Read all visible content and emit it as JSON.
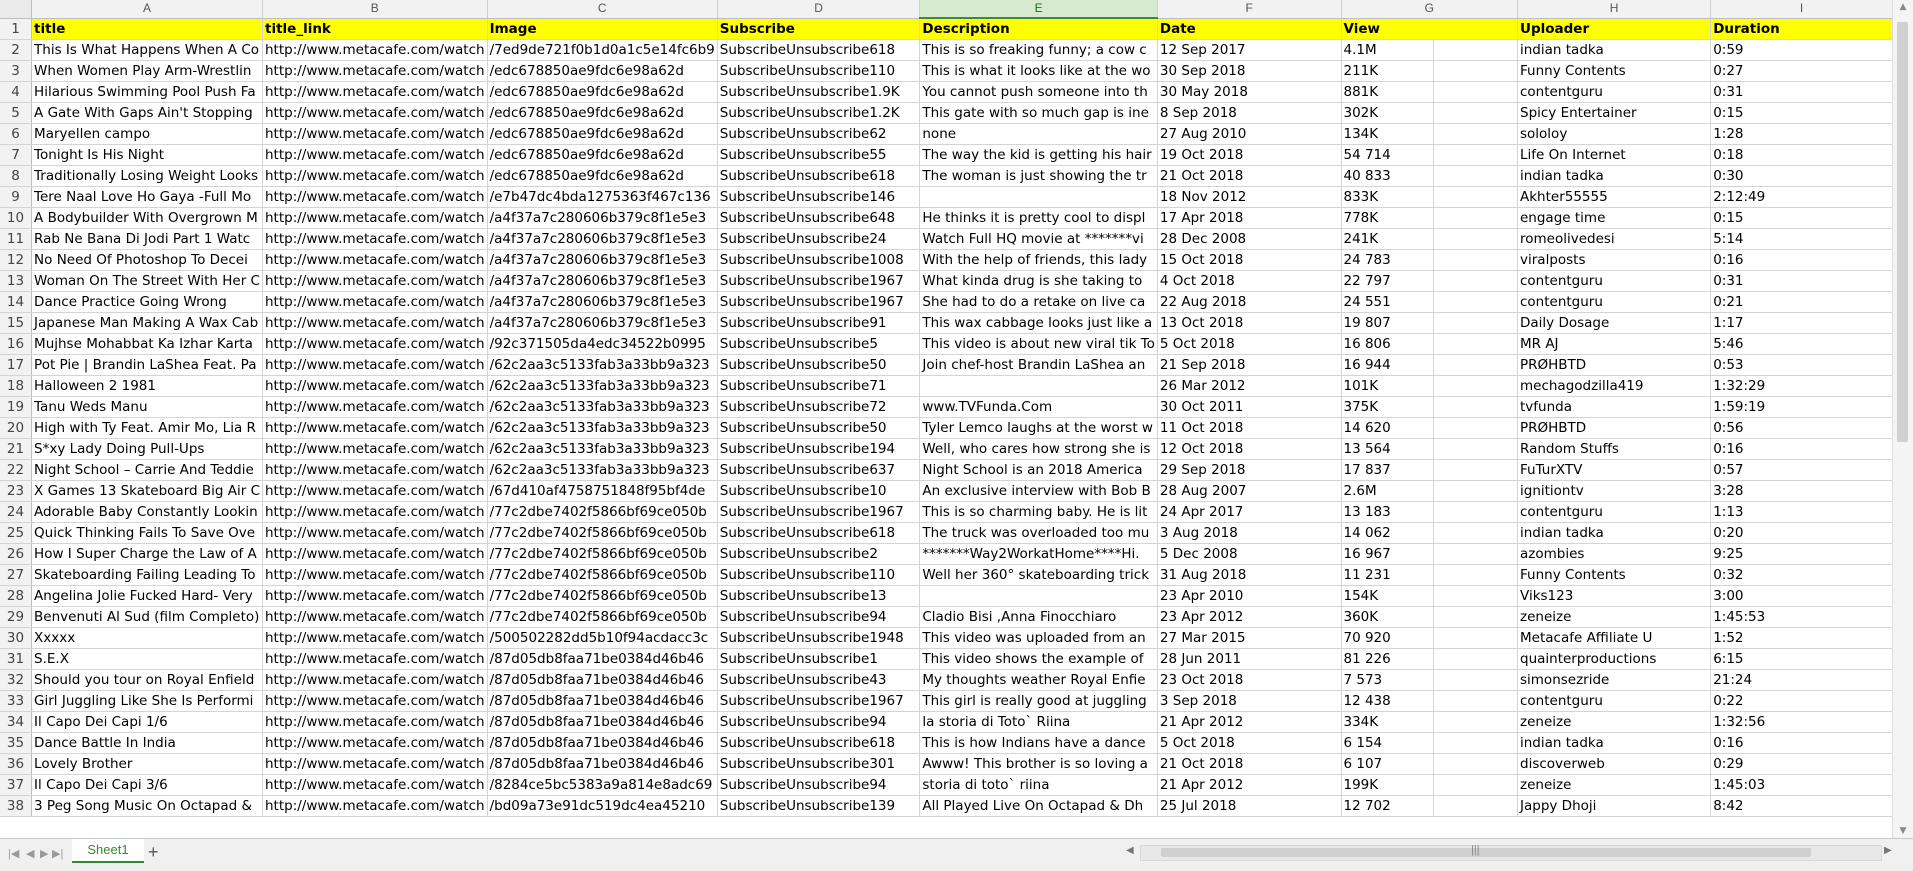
{
  "columns": {
    "letters": [
      "A",
      "B",
      "C",
      "D",
      "E",
      "F",
      "G",
      "H",
      "I"
    ],
    "active": "E"
  },
  "header_row": [
    "title",
    "title_link",
    "Image",
    "Subscribe",
    "Description",
    "Date",
    "View",
    "Uploader",
    "Duration"
  ],
  "rows": [
    {
      "n": "2",
      "cells": [
        "This Is What Happens When A Co",
        "http://www.metacafe.com/watch",
        "/7ed9de721f0b1d0a1c5e14fc6b9",
        "SubscribeUnsubscribe618",
        "This is so freaking funny; a cow c",
        "12 Sep 2017",
        "4.1M",
        "",
        "indian tadka",
        "0:59"
      ]
    },
    {
      "n": "3",
      "cells": [
        "When Women Play Arm-Wrestlin",
        "http://www.metacafe.com/watch",
        "/edc678850ae9fdc6e98a62d",
        "SubscribeUnsubscribe110",
        "This is what it looks like at the wo",
        "30 Sep 2018",
        "211K",
        "",
        "Funny Contents",
        "0:27"
      ]
    },
    {
      "n": "4",
      "cells": [
        "Hilarious Swimming Pool Push Fa",
        "http://www.metacafe.com/watch",
        "/edc678850ae9fdc6e98a62d",
        "SubscribeUnsubscribe1.9K",
        "You cannot push someone into th",
        "30 May 2018",
        "881K",
        "",
        "contentguru",
        "0:31"
      ]
    },
    {
      "n": "5",
      "cells": [
        "A Gate With Gaps Ain't Stopping",
        "http://www.metacafe.com/watch",
        "/edc678850ae9fdc6e98a62d",
        "SubscribeUnsubscribe1.2K",
        "This gate with so much gap is ine",
        "8 Sep 2018",
        "302K",
        "",
        "Spicy Entertainer",
        "0:15"
      ]
    },
    {
      "n": "6",
      "cells": [
        "Maryellen campo",
        "http://www.metacafe.com/watch",
        "/edc678850ae9fdc6e98a62d",
        "SubscribeUnsubscribe62",
        "none",
        "27 Aug 2010",
        "134K",
        "",
        "sololoy",
        "1:28"
      ]
    },
    {
      "n": "7",
      "cells": [
        "Tonight Is His Night",
        "http://www.metacafe.com/watch",
        "/edc678850ae9fdc6e98a62d",
        "SubscribeUnsubscribe55",
        "The way the kid is getting his hair",
        "19 Oct 2018",
        "54 714",
        "",
        "Life On Internet",
        "0:18"
      ]
    },
    {
      "n": "8",
      "cells": [
        "Traditionally Losing Weight Looks",
        "http://www.metacafe.com/watch",
        "/edc678850ae9fdc6e98a62d",
        "SubscribeUnsubscribe618",
        "The woman is just showing the tr",
        "21 Oct 2018",
        "40 833",
        "",
        "indian tadka",
        "0:30"
      ]
    },
    {
      "n": "9",
      "cells": [
        "Tere Naal Love Ho Gaya -Full Mo",
        "http://www.metacafe.com/watch",
        "/e7b47dc4bda1275363f467c136",
        "SubscribeUnsubscribe146",
        "",
        "18 Nov 2012",
        "833K",
        "",
        "Akhter55555",
        "2:12:49"
      ]
    },
    {
      "n": "10",
      "cells": [
        "A Bodybuilder With Overgrown M",
        "http://www.metacafe.com/watch",
        "/a4f37a7c280606b379c8f1e5e3",
        "SubscribeUnsubscribe648",
        "He thinks it is pretty cool to displ",
        "17 Apr 2018",
        "778K",
        "",
        "engage time",
        "0:15"
      ]
    },
    {
      "n": "11",
      "cells": [
        "Rab Ne Bana Di Jodi Part 1 Watc",
        "http://www.metacafe.com/watch",
        "/a4f37a7c280606b379c8f1e5e3",
        "SubscribeUnsubscribe24",
        "Watch Full HQ movie at *******vi",
        "28 Dec 2008",
        "241K",
        "",
        "romeolivedesi",
        "5:14"
      ]
    },
    {
      "n": "12",
      "cells": [
        "No Need Of Photoshop To Decei",
        "http://www.metacafe.com/watch",
        "/a4f37a7c280606b379c8f1e5e3",
        "SubscribeUnsubscribe1008",
        "With the help of friends, this lady",
        "15 Oct 2018",
        "24 783",
        "",
        "viralposts",
        "0:16"
      ]
    },
    {
      "n": "13",
      "cells": [
        "Woman On The Street With Her C",
        "http://www.metacafe.com/watch",
        "/a4f37a7c280606b379c8f1e5e3",
        "SubscribeUnsubscribe1967",
        "What kinda drug is she taking to",
        "4 Oct 2018",
        "22 797",
        "",
        "contentguru",
        "0:31"
      ]
    },
    {
      "n": "14",
      "cells": [
        "Dance Practice Going Wrong",
        "http://www.metacafe.com/watch",
        "/a4f37a7c280606b379c8f1e5e3",
        "SubscribeUnsubscribe1967",
        "She had to do a retake on live ca",
        "22 Aug 2018",
        "24 551",
        "",
        "contentguru",
        "0:21"
      ]
    },
    {
      "n": "15",
      "cells": [
        "Japanese Man Making A Wax Cab",
        "http://www.metacafe.com/watch",
        "/a4f37a7c280606b379c8f1e5e3",
        "SubscribeUnsubscribe91",
        "This wax cabbage looks just like a",
        "13 Oct 2018",
        "19 807",
        "",
        "Daily Dosage",
        "1:17"
      ]
    },
    {
      "n": "16",
      "cells": [
        "Mujhse Mohabbat Ka Izhar Karta",
        "http://www.metacafe.com/watch",
        "/92c371505da4edc34522b0995",
        "SubscribeUnsubscribe5",
        "This video is about new viral tik To",
        "5 Oct 2018",
        "16 806",
        "",
        "MR AJ",
        "5:46"
      ]
    },
    {
      "n": "17",
      "cells": [
        "Pot Pie | Brandin LaShea Feat. Pa",
        "http://www.metacafe.com/watch",
        "/62c2aa3c5133fab3a33bb9a323",
        "SubscribeUnsubscribe50",
        "Join chef-host Brandin LaShea an",
        "21 Sep 2018",
        "16 944",
        "",
        "PRØHBTD",
        "0:53"
      ]
    },
    {
      "n": "18",
      "cells": [
        "Halloween 2 1981",
        "http://www.metacafe.com/watch",
        "/62c2aa3c5133fab3a33bb9a323",
        "SubscribeUnsubscribe71",
        "",
        "26 Mar 2012",
        "101K",
        "",
        "mechagodzilla419",
        "1:32:29"
      ]
    },
    {
      "n": "19",
      "cells": [
        "Tanu Weds Manu",
        "http://www.metacafe.com/watch",
        "/62c2aa3c5133fab3a33bb9a323",
        "SubscribeUnsubscribe72",
        "www.TVFunda.Com",
        "30 Oct 2011",
        "375K",
        "",
        "tvfunda",
        "1:59:19"
      ]
    },
    {
      "n": "20",
      "cells": [
        "High with Ty Feat. Amir Mo, Lia R",
        "http://www.metacafe.com/watch",
        "/62c2aa3c5133fab3a33bb9a323",
        "SubscribeUnsubscribe50",
        "Tyler Lemco laughs at the worst w",
        "11 Oct 2018",
        "14 620",
        "",
        "PRØHBTD",
        "0:56"
      ]
    },
    {
      "n": "21",
      "cells": [
        "S*xy Lady Doing Pull-Ups",
        "http://www.metacafe.com/watch",
        "/62c2aa3c5133fab3a33bb9a323",
        "SubscribeUnsubscribe194",
        "Well, who cares how strong she is",
        "12 Oct 2018",
        "13 564",
        "",
        "Random Stuffs",
        "0:16"
      ]
    },
    {
      "n": "22",
      "cells": [
        "Night School – Carrie And Teddie",
        "http://www.metacafe.com/watch",
        "/62c2aa3c5133fab3a33bb9a323",
        "SubscribeUnsubscribe637",
        "Night School is an 2018 America",
        "29 Sep 2018",
        "17 837",
        "",
        "FuTurXTV",
        "0:57"
      ]
    },
    {
      "n": "23",
      "cells": [
        "X Games 13 Skateboard Big Air C",
        "http://www.metacafe.com/watch",
        "/67d410af4758751848f95bf4de",
        "SubscribeUnsubscribe10",
        "An exclusive interview with Bob B",
        "28 Aug 2007",
        "2.6M",
        "",
        "ignitiontv",
        "3:28"
      ]
    },
    {
      "n": "24",
      "cells": [
        "Adorable Baby Constantly Lookin",
        "http://www.metacafe.com/watch",
        "/77c2dbe7402f5866bf69ce050b",
        "SubscribeUnsubscribe1967",
        "This is so charming baby. He is lit",
        "24 Apr 2017",
        "13 183",
        "",
        "contentguru",
        "1:13"
      ]
    },
    {
      "n": "25",
      "cells": [
        "Quick Thinking Fails To Save Ove",
        "http://www.metacafe.com/watch",
        "/77c2dbe7402f5866bf69ce050b",
        "SubscribeUnsubscribe618",
        "The truck was overloaded too mu",
        "3 Aug 2018",
        "14 062",
        "",
        "indian tadka",
        "0:20"
      ]
    },
    {
      "n": "26",
      "cells": [
        "How I Super Charge the Law of A",
        "http://www.metacafe.com/watch",
        "/77c2dbe7402f5866bf69ce050b",
        "SubscribeUnsubscribe2",
        "*******Way2WorkatHome****Hi.",
        "5 Dec 2008",
        "16 967",
        "",
        "azombies",
        "9:25"
      ]
    },
    {
      "n": "27",
      "cells": [
        "Skateboarding Failing Leading To",
        "http://www.metacafe.com/watch",
        "/77c2dbe7402f5866bf69ce050b",
        "SubscribeUnsubscribe110",
        "Well her 360° skateboarding trick",
        "31 Aug 2018",
        "11 231",
        "",
        "Funny Contents",
        "0:32"
      ]
    },
    {
      "n": "28",
      "cells": [
        "Angelina Jolie Fucked Hard- Very",
        "http://www.metacafe.com/watch",
        "/77c2dbe7402f5866bf69ce050b",
        "SubscribeUnsubscribe13",
        "",
        "23 Apr 2010",
        "154K",
        "",
        "Viks123",
        "3:00"
      ]
    },
    {
      "n": "29",
      "cells": [
        "Benvenuti Al Sud (film Completo)",
        "http://www.metacafe.com/watch",
        "/77c2dbe7402f5866bf69ce050b",
        "SubscribeUnsubscribe94",
        "Cladio Bisi ,Anna Finocchiaro",
        "23 Apr 2012",
        "360K",
        "",
        "zeneize",
        "1:45:53"
      ]
    },
    {
      "n": "30",
      "cells": [
        "Xxxxx",
        "http://www.metacafe.com/watch",
        "/500502282dd5b10f94acdacc3c",
        "SubscribeUnsubscribe1948",
        "This video was uploaded from an",
        "27 Mar 2015",
        "70 920",
        "",
        "Metacafe Affiliate U",
        "1:52"
      ]
    },
    {
      "n": "31",
      "cells": [
        "S.E.X",
        "http://www.metacafe.com/watch",
        "/87d05db8faa71be0384d46b46",
        "SubscribeUnsubscribe1",
        "This video shows the example of",
        "28 Jun 2011",
        "81 226",
        "",
        "quainterproductions",
        "6:15"
      ]
    },
    {
      "n": "32",
      "cells": [
        "Should you tour on Royal Enfield",
        "http://www.metacafe.com/watch",
        "/87d05db8faa71be0384d46b46",
        "SubscribeUnsubscribe43",
        "My thoughts weather Royal Enfie",
        "23 Oct 2018",
        "7 573",
        "",
        "simonsezride",
        "21:24"
      ]
    },
    {
      "n": "33",
      "cells": [
        "Girl Juggling Like She Is Performi",
        "http://www.metacafe.com/watch",
        "/87d05db8faa71be0384d46b46",
        "SubscribeUnsubscribe1967",
        "This girl is really good at juggling",
        "3 Sep 2018",
        "12 438",
        "",
        "contentguru",
        "0:22"
      ]
    },
    {
      "n": "34",
      "cells": [
        "Il Capo Dei Capi 1/6",
        "http://www.metacafe.com/watch",
        "/87d05db8faa71be0384d46b46",
        "SubscribeUnsubscribe94",
        "la storia di Toto` Riina",
        "21 Apr 2012",
        "334K",
        "",
        "zeneize",
        "1:32:56"
      ]
    },
    {
      "n": "35",
      "cells": [
        "Dance Battle In India",
        "http://www.metacafe.com/watch",
        "/87d05db8faa71be0384d46b46",
        "SubscribeUnsubscribe618",
        "This is how Indians have a dance",
        "5 Oct 2018",
        "6 154",
        "",
        "indian tadka",
        "0:16"
      ]
    },
    {
      "n": "36",
      "cells": [
        "Lovely Brother",
        "http://www.metacafe.com/watch",
        "/87d05db8faa71be0384d46b46",
        "SubscribeUnsubscribe301",
        "Awww! This brother is so loving a",
        "21 Oct 2018",
        "6 107",
        "",
        "discoverweb",
        "0:29"
      ]
    },
    {
      "n": "37",
      "cells": [
        "Il Capo Dei Capi 3/6",
        "http://www.metacafe.com/watch",
        "/8284ce5bc5383a9a814e8adc69",
        "SubscribeUnsubscribe94",
        "storia di toto` riina",
        "21 Apr 2012",
        "199K",
        "",
        "zeneize",
        "1:45:03"
      ]
    },
    {
      "n": "38",
      "cells": [
        "3 Peg Song Music On Octapad &",
        "http://www.metacafe.com/watch",
        "/bd09a73e91dc519dc4ea45210",
        "SubscribeUnsubscribe139",
        "All Played Live On Octapad & Dh",
        "25 Jul 2018",
        "12 702",
        "",
        "Jappy Dhoji",
        "8:42"
      ]
    }
  ],
  "sheet_tabs": [
    {
      "label": "Sheet1",
      "active": true
    }
  ],
  "add_sheet_symbol": "+",
  "colors": {
    "header_fill": "#ffff00",
    "active_tab": "#2e8b2e",
    "active_col_header": "#d6ead0"
  }
}
